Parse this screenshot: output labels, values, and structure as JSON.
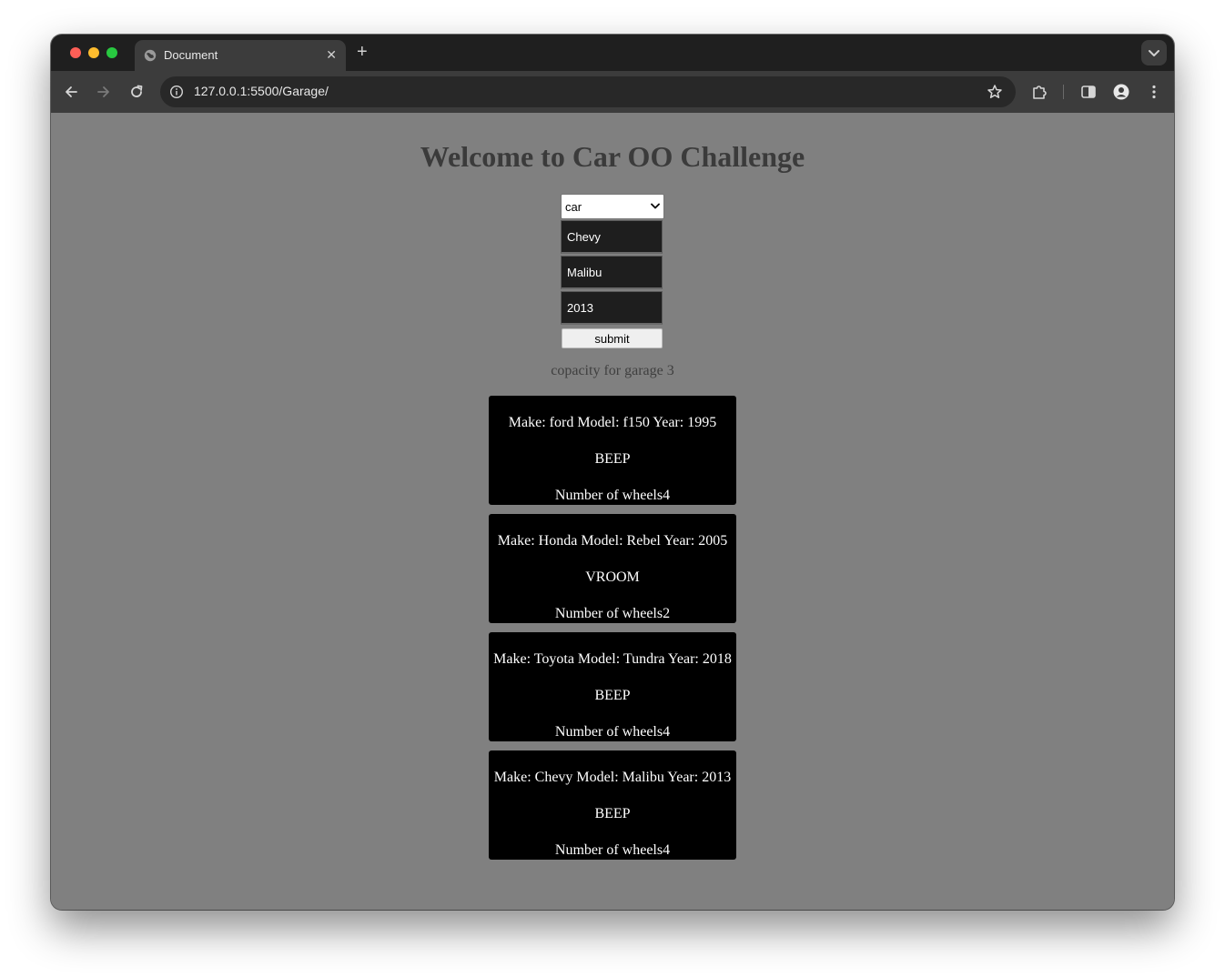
{
  "browser": {
    "tab_title": "Document",
    "url": "127.0.0.1:5500/Garage/",
    "tab_close_glyph": "✕",
    "new_tab_glyph": "+"
  },
  "page": {
    "heading": "Welcome to Car OO Challenge",
    "vehicle_type": {
      "selected": "car"
    },
    "inputs": {
      "make": "Chevy",
      "model": "Malibu",
      "year": "2013"
    },
    "submit_label": "submit",
    "capacity_text": "copacity for garage 3",
    "vehicles": [
      {
        "info": "Make: ford Model: f150 Year: 1995",
        "sound": "BEEP",
        "wheels": "Number of wheels4"
      },
      {
        "info": "Make: Honda Model: Rebel Year: 2005",
        "sound": "VROOM",
        "wheels": "Number of wheels2"
      },
      {
        "info": "Make: Toyota Model: Tundra Year: 2018",
        "sound": "BEEP",
        "wheels": "Number of wheels4"
      },
      {
        "info": "Make: Chevy Model: Malibu Year: 2013",
        "sound": "BEEP",
        "wheels": "Number of wheels4"
      }
    ]
  },
  "icons": {
    "favicon": "globe-icon",
    "back": "arrow-left-icon",
    "forward": "arrow-right-icon",
    "reload": "reload-icon",
    "site_info": "info-icon",
    "bookmark": "star-icon",
    "extensions": "puzzle-icon",
    "side_panel": "side-panel-icon",
    "profile": "profile-icon",
    "menu": "kebab-menu-icon",
    "tab_search": "chevron-down-icon"
  },
  "colors": {
    "page_background": "#808080",
    "card_background": "#000000",
    "card_text": "#ffffff",
    "heading_text": "#3b3b3b",
    "input_background": "#1e1e1e"
  }
}
